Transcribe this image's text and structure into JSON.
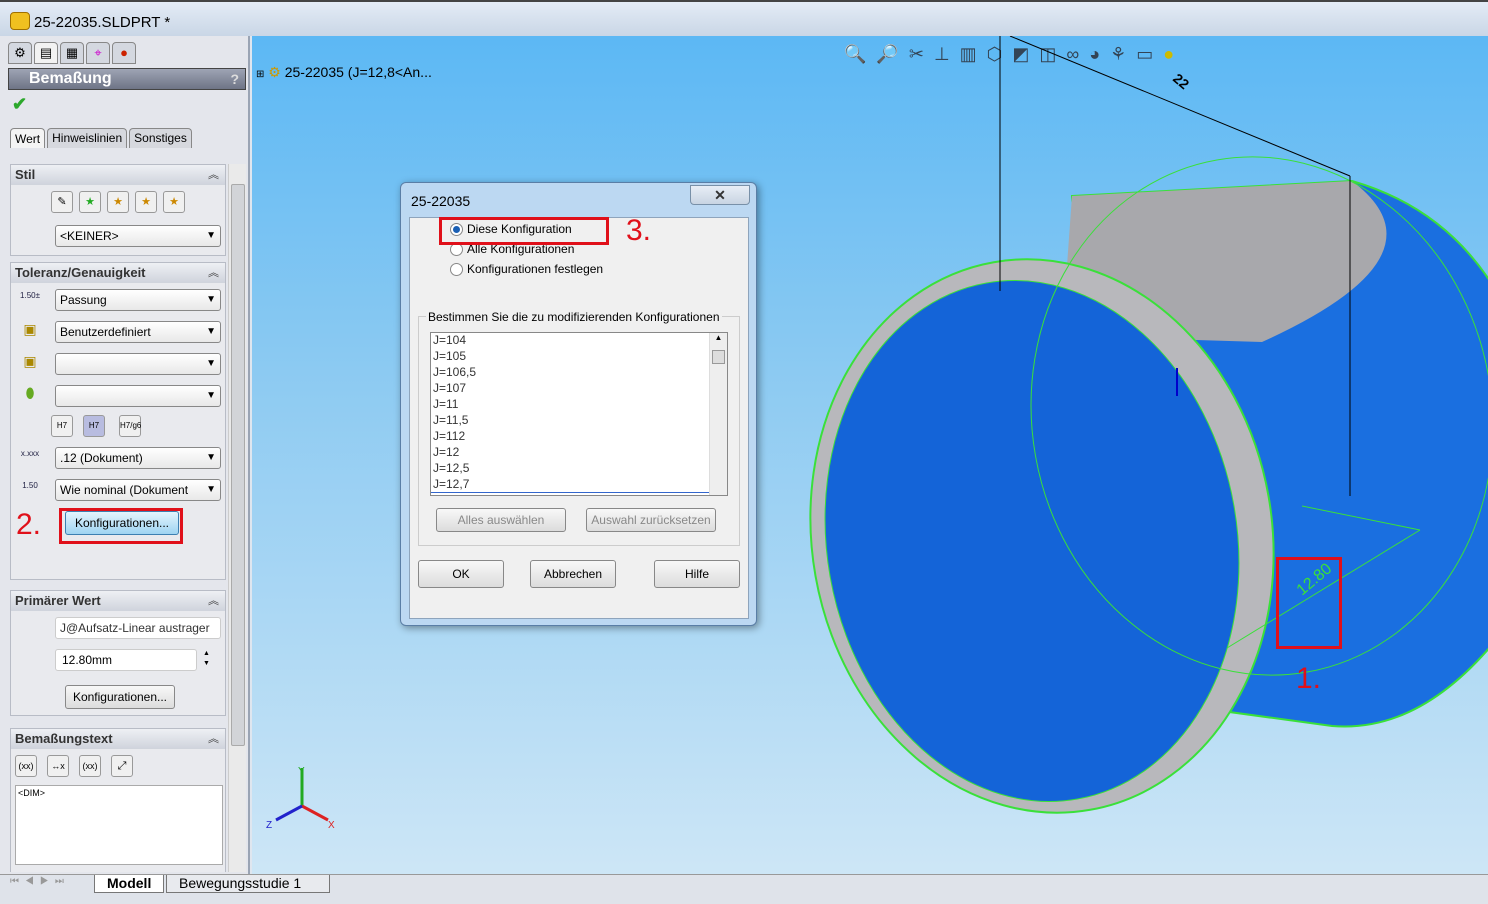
{
  "window": {
    "title": "25-22035.SLDPRT *"
  },
  "property_manager": {
    "title": "Bemaßung",
    "help": "?",
    "tabs": [
      "Wert",
      "Hinweislinien",
      "Sonstiges"
    ],
    "stil": {
      "header": "Stil",
      "style_value": "<KEINER>"
    },
    "toleranz": {
      "header": "Toleranz/Genauigkeit",
      "tolerance_type": "Passung",
      "classification": "Benutzerdefiniert",
      "hole_fit": "",
      "shaft_fit": "",
      "fit_buttons": [
        "H7/g6 gestapelt",
        "H7/g6 gestapelt Linie",
        "H7/g6"
      ],
      "precision": ".12 (Dokument)",
      "tolerance_precision": "Wie nominal (Dokument",
      "config_button": "Konfigurationen..."
    },
    "primaer": {
      "header": "Primärer Wert",
      "name": "J@Aufsatz-Linear austrager",
      "value": "12.80mm",
      "config_button": "Konfigurationen..."
    },
    "text": {
      "header": "Bemaßungstext",
      "content": "<DIM>"
    }
  },
  "graphics": {
    "tree_item": "25-22035  (J=12,8<An...",
    "dimension_value": "12.80",
    "dimension_top": "22"
  },
  "dialog": {
    "title": "25-22035",
    "close": "✕",
    "options": [
      "Diese Konfiguration",
      "Alle Konfigurationen",
      "Konfigurationen festlegen"
    ],
    "list_label": "Bestimmen Sie die zu modifizierenden Konfigurationen",
    "configs": [
      "J=104",
      "J=105",
      "J=106,5",
      "J=107",
      "J=11",
      "J=11,5",
      "J=112",
      "J=12",
      "J=12,5",
      "J=12,7"
    ],
    "select_all": "Alles auswählen",
    "reset": "Auswahl zurücksetzen",
    "ok": "OK",
    "cancel": "Abbrechen",
    "help": "Hilfe"
  },
  "annotations": {
    "step1": "1.",
    "step2": "2.",
    "step3": "3."
  },
  "bottom_tabs": [
    "Modell",
    "Bewegungsstudie 1"
  ],
  "colors": {
    "accent_red": "#e0101a",
    "model_blue": "#1a6fe0",
    "edge_green": "#3ae03a"
  }
}
